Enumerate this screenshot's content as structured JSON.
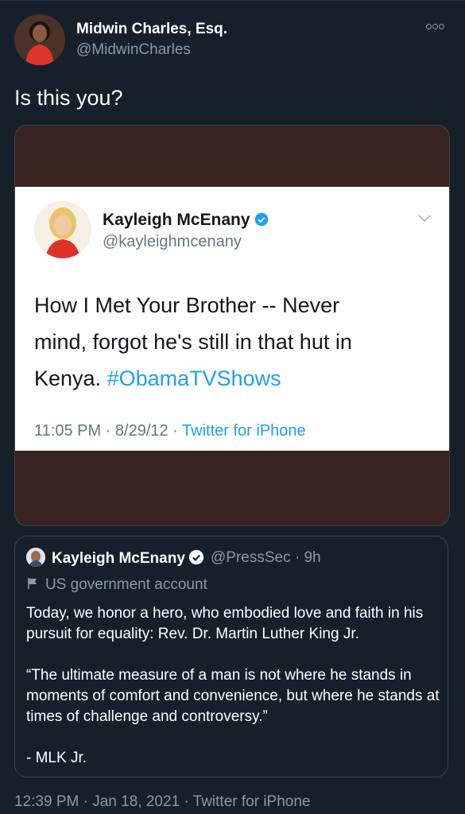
{
  "tweet": {
    "author_name": "Midwin Charles, Esq.",
    "author_handle": "@MidwinCharles",
    "text": "Is this you?",
    "timestamp": "12:39 PM · Jan 18, 2021",
    "source_separator": "·",
    "source": "Twitter for iPhone"
  },
  "media": {
    "author_name": "Kayleigh McEnany",
    "author_handle": "@kayleighmcenany",
    "text_line1": "How I Met Your Brother -- Never",
    "text_line2": "mind, forgot he's still in that hut in",
    "text_line3_prefix": "Kenya. ",
    "hashtag": "#ObamaTVShows",
    "time": "11:05 PM · 8/29/12 · ",
    "source": "Twitter for iPhone"
  },
  "quote": {
    "author_name": "Kayleigh McEnany",
    "author_handle": "@PressSec · 9h",
    "account_label": "US government account",
    "paragraph1": "Today, we honor a hero, who embodied love and faith in his pursuit for equality: Rev. Dr. Martin Luther King Jr.",
    "paragraph2": "“The ultimate measure of a man is not where he stands in moments of comfort and convenience, but where he stands at times of challenge and controversy.”",
    "paragraph3": "- MLK Jr."
  },
  "colors": {
    "background": "#15202b",
    "secondary_text": "#8899a6",
    "link_blue": "#1da1f2",
    "media_backdrop": "#3a2422"
  },
  "icons": {
    "more": "more-options-icon",
    "verified": "verified-badge-icon",
    "chevron": "chevron-down-icon",
    "flag": "government-flag-icon"
  }
}
